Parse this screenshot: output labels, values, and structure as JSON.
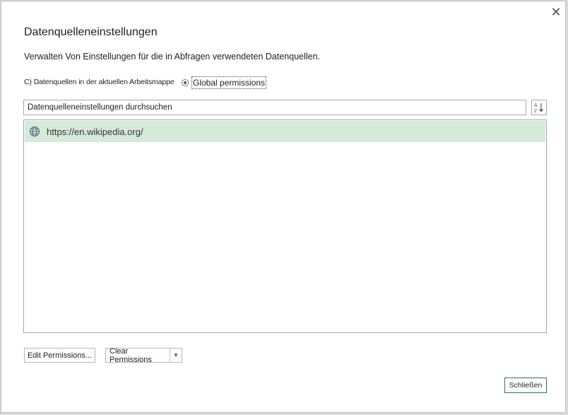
{
  "dialog": {
    "title": "Datenquelleneinstellungen",
    "description": "Verwalten Von Einstellungen für die in Abfragen verwendeten Datenquellen.",
    "close_glyph": "✕"
  },
  "scope": {
    "option_current": "C) Datenquellen in der aktuellen Arbeitsmappe",
    "option_global": "Global permissions",
    "selected": "global"
  },
  "search": {
    "value": "Datenquelleneinstellungen durchsuchen",
    "sort_icon": "sort-az-icon"
  },
  "sources": [
    {
      "label": "https://en.wikipedia.org/",
      "icon": "globe-icon",
      "selected": true
    }
  ],
  "buttons": {
    "edit_permissions": "Edit Permissions...",
    "clear_permissions": "Clear Permissions",
    "close": "Schließen"
  },
  "colors": {
    "selected_row": "#d6ead9",
    "close_button_border": "#3b6e4f"
  }
}
